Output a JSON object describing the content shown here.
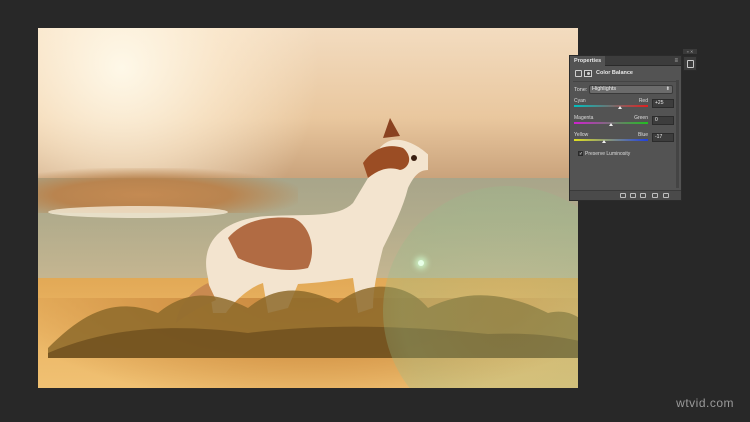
{
  "panel": {
    "tab_title": "Properties",
    "adjustment_name": "Color Balance",
    "tone_label": "Tone:",
    "tone_value": "Highlights",
    "sliders": [
      {
        "left": "Cyan",
        "right": "Red",
        "value": "+25",
        "fraction": 0.62,
        "gradient_from": "#00c0c0",
        "gradient_to": "#e02020"
      },
      {
        "left": "Magenta",
        "right": "Green",
        "value": "0",
        "fraction": 0.5,
        "gradient_from": "#d020d0",
        "gradient_to": "#20c020"
      },
      {
        "left": "Yellow",
        "right": "Blue",
        "value": "-17",
        "fraction": 0.41,
        "gradient_from": "#e0e020",
        "gradient_to": "#2040e0"
      }
    ],
    "preserve_luminosity_label": "Preserve Luminosity",
    "preserve_luminosity_checked": true
  },
  "watermark": "wtvid.com"
}
